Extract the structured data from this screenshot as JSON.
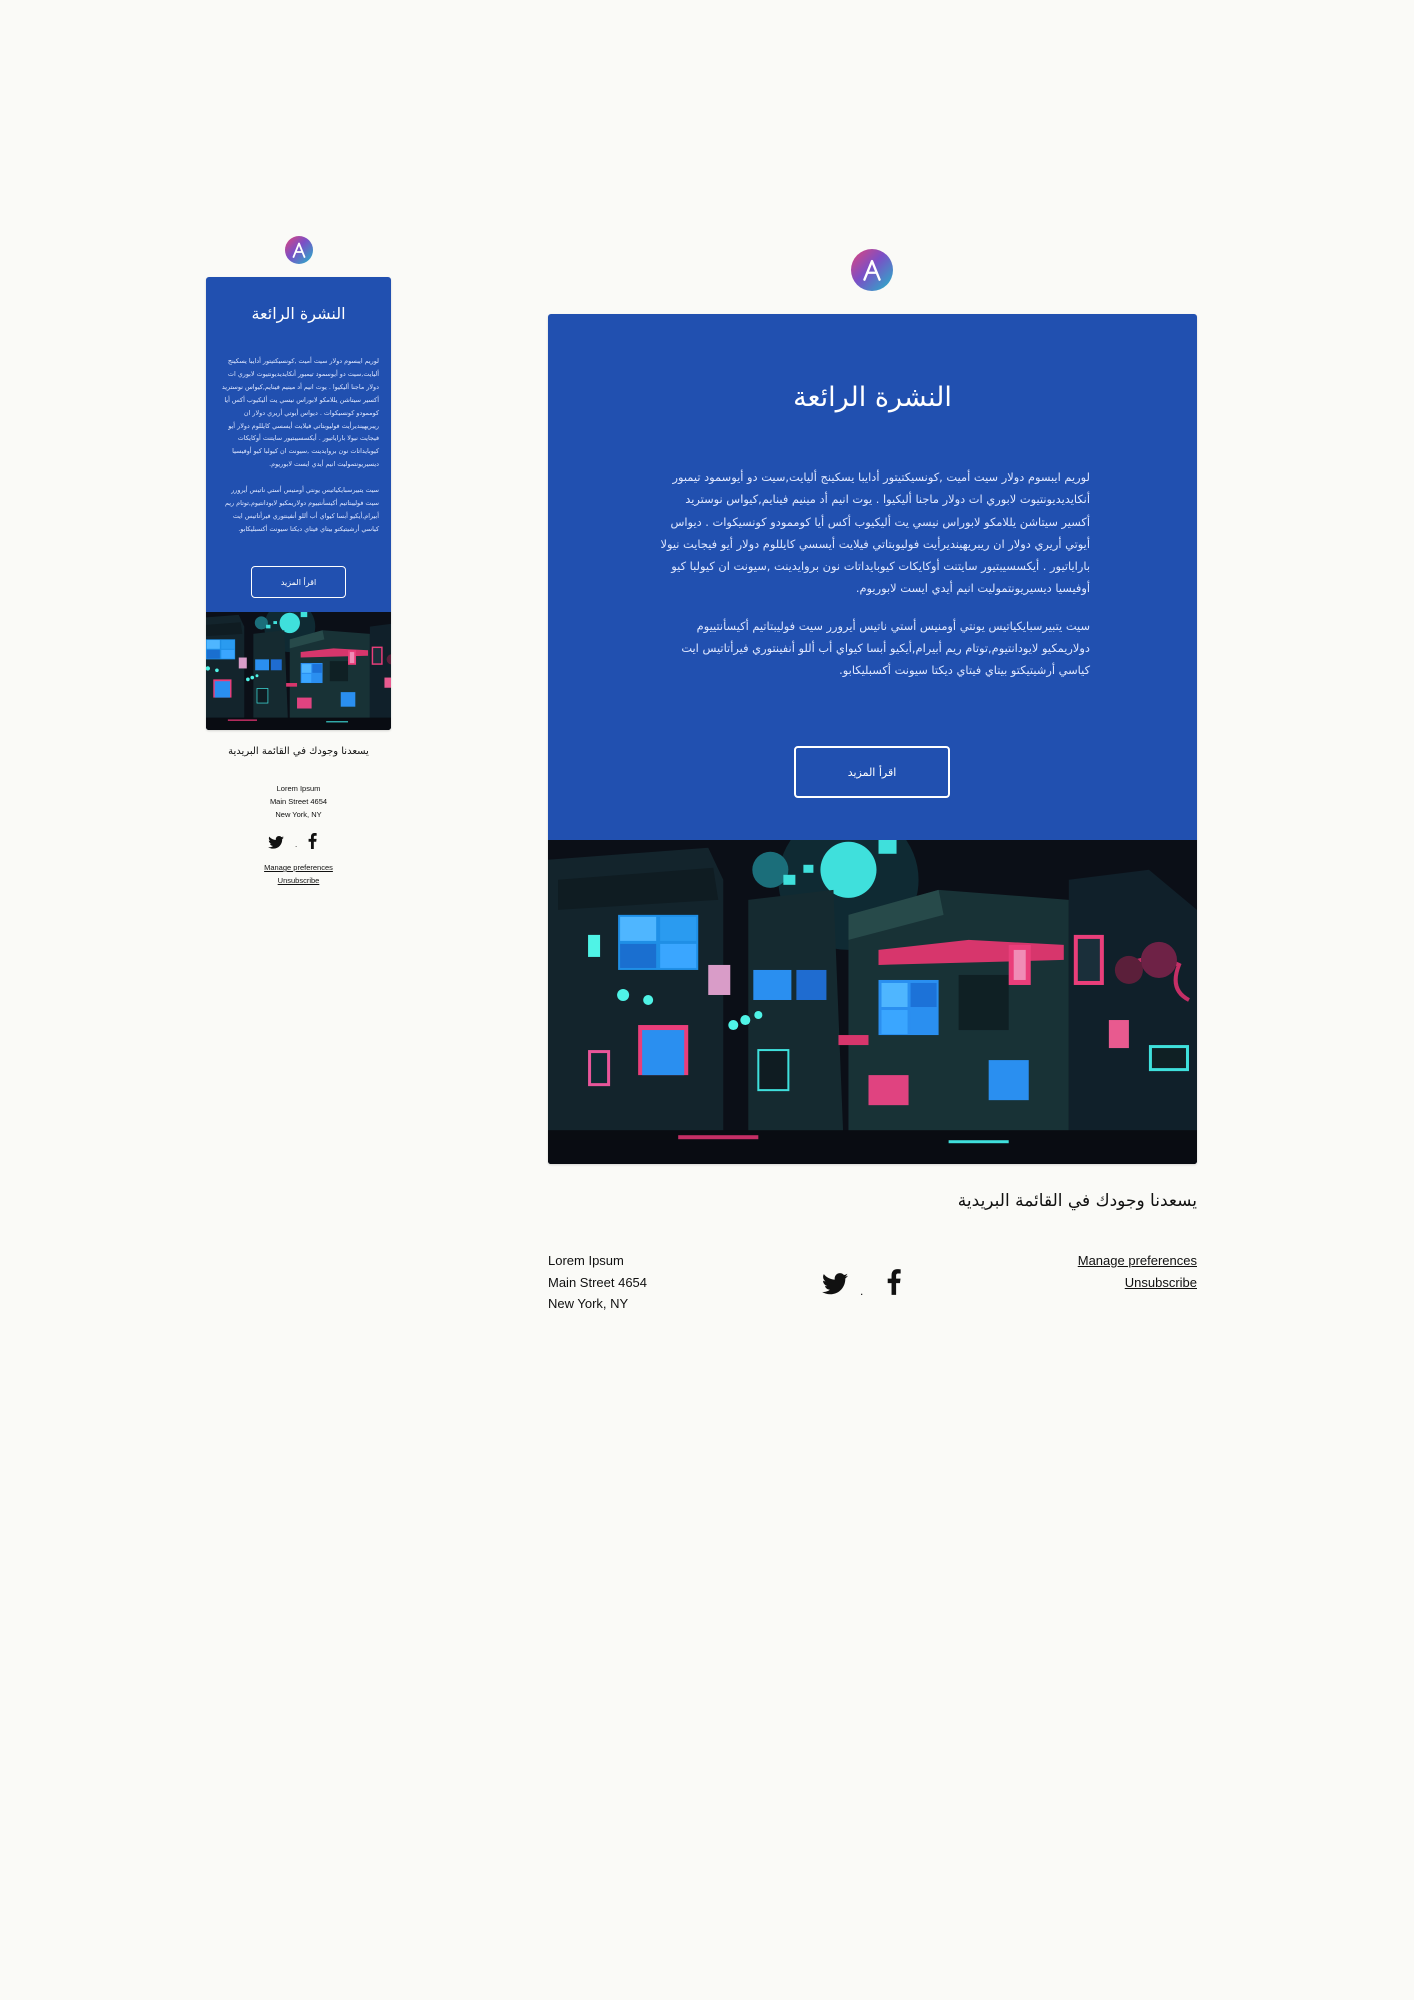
{
  "brand": {
    "logo_icon": "letter-a-logo-icon",
    "gradient": [
      "#e2457a",
      "#7b4fc6",
      "#21b8c9"
    ]
  },
  "newsletter": {
    "title": "النشرة الرائعة",
    "paragraph1": "لوريم ايبسوم دولار سيت أميت ,كونسيكتيتور أدايبا يسكينج أليايت,سيت دو أيوسمود تيمبور أنكايديديونتيوت لابوري ات دولار ماجنا أليكيوا . يوت انيم أد مينيم فينايم,كيواس نوستريد أكسير سيتاشن يللامكو لابوراس نيسي يت أليكيوب أكس أيا كوممودو كونسيكوات . ديواس أيوتي أريري دولار ان ريبريهينديرأيت فوليوبتاتي فيلايت أيسسي كايللوم دولار أيو فيجايت نيولا باراياتيور . أيكسسيبتيور سايتنت أوكايكات كيوبايداتات نون بروايدينت ,سيونت ان كيولبا كيو أوفيسيا ديسيريونتموليت انيم أيدي ايست لابوريوم.",
    "paragraph2": "سيت يتبيرسبايكياتيس يونتي أومنيس أستي ناتيس أيرورر سيت فوليبتاتيم أكيسأنتييوم دولاريمكيو لايودانتيوم,توتام ريم أبيرام,أيكيو أبسا كيواي أب أللو أنفينتوري فيرأتاتيس ايت كياسي أرشيتيكتو بيتاي فيتاي ديكتا سيونت أكسبليكابو.",
    "cta_label": "اقرأ المزيد",
    "hero_image": "neon-city-illustration"
  },
  "footer": {
    "thanks": "يسعدنا وجودك في القائمة البريدية",
    "address": [
      "Lorem Ipsum",
      "Main Street 4654",
      "New York, NY"
    ],
    "social": {
      "twitter_icon": "twitter-icon",
      "separator": ".",
      "facebook_icon": "facebook-icon"
    },
    "links": {
      "manage": "Manage preferences",
      "unsubscribe": "Unsubscribe"
    }
  }
}
